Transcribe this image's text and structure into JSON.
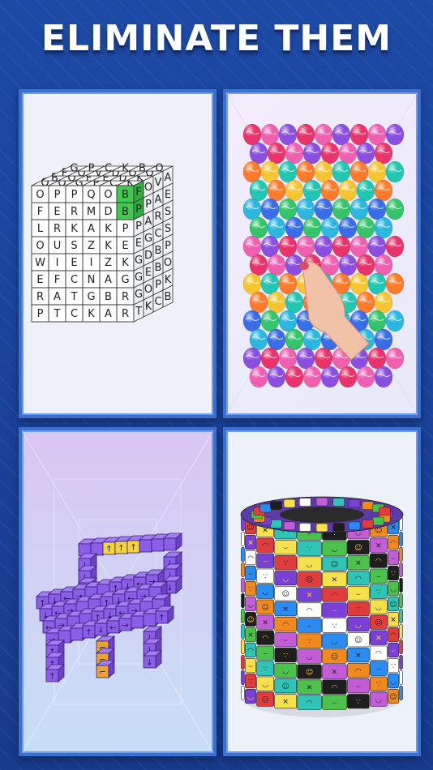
{
  "title": "ELIMINATE THEM",
  "panels": [
    {
      "name": "word-cube",
      "front_letters": [
        [
          "O",
          "P",
          "P",
          "Q",
          "O",
          "B"
        ],
        [
          "F",
          "E",
          "R",
          "M",
          "D",
          "B"
        ],
        [
          "L",
          "R",
          "K",
          "A",
          "K",
          "P"
        ],
        [
          "O",
          "U",
          "S",
          "Z",
          "K",
          "E"
        ],
        [
          "W",
          "I",
          "E",
          "I",
          "Z",
          "K"
        ],
        [
          "E",
          "F",
          "C",
          "N",
          "A",
          "G"
        ],
        [
          "R",
          "A",
          "T",
          "G",
          "B",
          "R"
        ],
        [
          "P",
          "T",
          "C",
          "K",
          "A",
          "R"
        ]
      ],
      "side_letters": [
        [
          "F",
          "O",
          "V",
          "A"
        ],
        [
          "P",
          "P",
          "A",
          "E"
        ],
        [
          "P",
          "A",
          "R",
          "S"
        ],
        [
          "E",
          "G",
          "C",
          "S"
        ],
        [
          "G",
          "D",
          "B",
          "P"
        ],
        [
          "G",
          "E",
          "B",
          "O"
        ],
        [
          "G",
          "O",
          "P",
          "K"
        ],
        [
          "T",
          "K",
          "C",
          "B"
        ]
      ],
      "top_letters": [
        "O",
        "O",
        "G",
        "P",
        "C",
        "K",
        "B",
        "O",
        "F",
        "E",
        "D",
        "K",
        "F",
        "O",
        "V",
        "D"
      ],
      "highlight_color": "#3fc94f"
    },
    {
      "name": "balloon-cylinder"
    },
    {
      "name": "purple-truck"
    },
    {
      "name": "halloween-cylinder"
    }
  ],
  "colors": {
    "background": "#1a3f93",
    "panel_border": "#3b6fd0"
  }
}
